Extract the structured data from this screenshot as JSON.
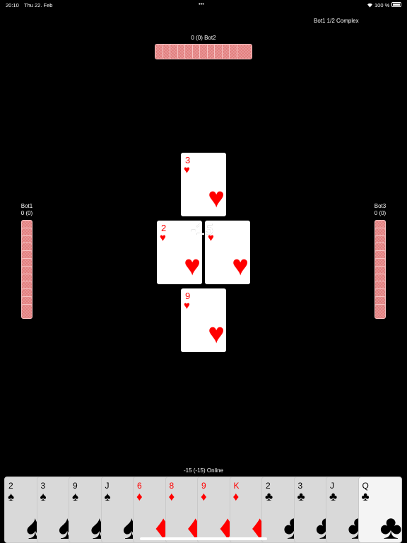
{
  "status_bar": {
    "time": "20:10",
    "date": "Thu 22. Feb",
    "dots": "•••",
    "battery": "100 %"
  },
  "game_info": "Bot1  1/2  Complex",
  "players": {
    "top": {
      "label": "0  (0) Bot2",
      "cards_in_hand": 12
    },
    "left": {
      "name": "Bot1",
      "score": "0  (0)",
      "cards_in_hand": 12
    },
    "right": {
      "name": "Bot3",
      "score": "0  (0)",
      "cards_in_hand": 12
    },
    "bottom": {
      "label": "-15  (-15) Online"
    }
  },
  "trick": {
    "score": "-15",
    "top": {
      "rank": "3",
      "suit": "♥"
    },
    "left": {
      "rank": "2",
      "suit": "♥"
    },
    "right": {
      "rank": "",
      "suit": "♥"
    },
    "bottom": {
      "rank": "9",
      "suit": "♥"
    }
  },
  "hand": [
    {
      "rank": "2",
      "suit": "♠",
      "color": "black"
    },
    {
      "rank": "3",
      "suit": "♠",
      "color": "black"
    },
    {
      "rank": "9",
      "suit": "♠",
      "color": "black"
    },
    {
      "rank": "J",
      "suit": "♠",
      "color": "black"
    },
    {
      "rank": "6",
      "suit": "♦",
      "color": "red"
    },
    {
      "rank": "8",
      "suit": "♦",
      "color": "red"
    },
    {
      "rank": "9",
      "suit": "♦",
      "color": "red"
    },
    {
      "rank": "K",
      "suit": "♦",
      "color": "red"
    },
    {
      "rank": "2",
      "suit": "♣",
      "color": "black"
    },
    {
      "rank": "3",
      "suit": "♣",
      "color": "black"
    },
    {
      "rank": "J",
      "suit": "♣",
      "color": "black"
    },
    {
      "rank": "Q",
      "suit": "♣",
      "color": "black"
    }
  ],
  "colors": {
    "background": "#000000",
    "card_back": "#e27b7b",
    "red_suit": "#ff0000"
  }
}
